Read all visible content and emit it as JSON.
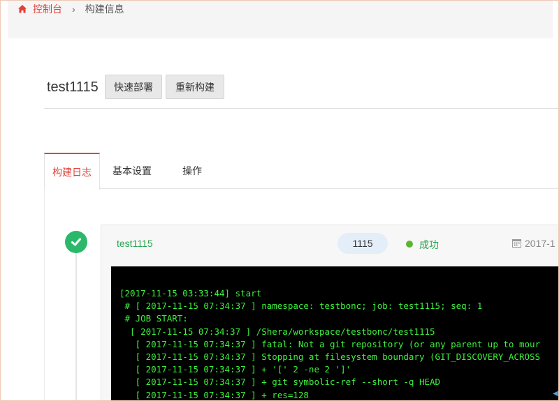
{
  "breadcrumb": {
    "home": "控制台",
    "separator": "›",
    "current": "构建信息"
  },
  "header": {
    "title": "test1115",
    "deploy_label": "快速部署",
    "rebuild_label": "重新构建"
  },
  "tabs": [
    {
      "label": "构建日志",
      "active": true
    },
    {
      "label": "基本设置",
      "active": false
    },
    {
      "label": "操作",
      "active": false
    }
  ],
  "build": {
    "name": "test1115",
    "seq": "1115",
    "status": "成功",
    "date": "2017-1"
  },
  "console": {
    "lines": [
      "[2017-11-15 03:33:44] start",
      " # [ 2017-11-15 07:34:37 ] namespace: testbonc; job: test1115; seq: 1",
      " # JOB START:",
      "  [ 2017-11-15 07:34:37 ] /Shera/workspace/testbonc/test1115",
      "   [ 2017-11-15 07:34:37 ] fatal: Not a git repository (or any parent up to mour",
      "   [ 2017-11-15 07:34:37 ] Stopping at filesystem boundary (GIT_DISCOVERY_ACROSS",
      "   [ 2017-11-15 07:34:37 ] + '[' 2 -ne 2 ']'",
      "   [ 2017-11-15 07:34:37 ] + git symbolic-ref --short -q HEAD",
      "   [ 2017-11-15 07:34:37 ] + res=128"
    ]
  },
  "icons": {
    "home": "home-icon",
    "check": "check-icon",
    "calendar": "calendar-icon"
  },
  "colors": {
    "accent": "#e0423a",
    "success": "#2aa44f",
    "console_text": "#3df13d",
    "console_bg": "#000000"
  }
}
